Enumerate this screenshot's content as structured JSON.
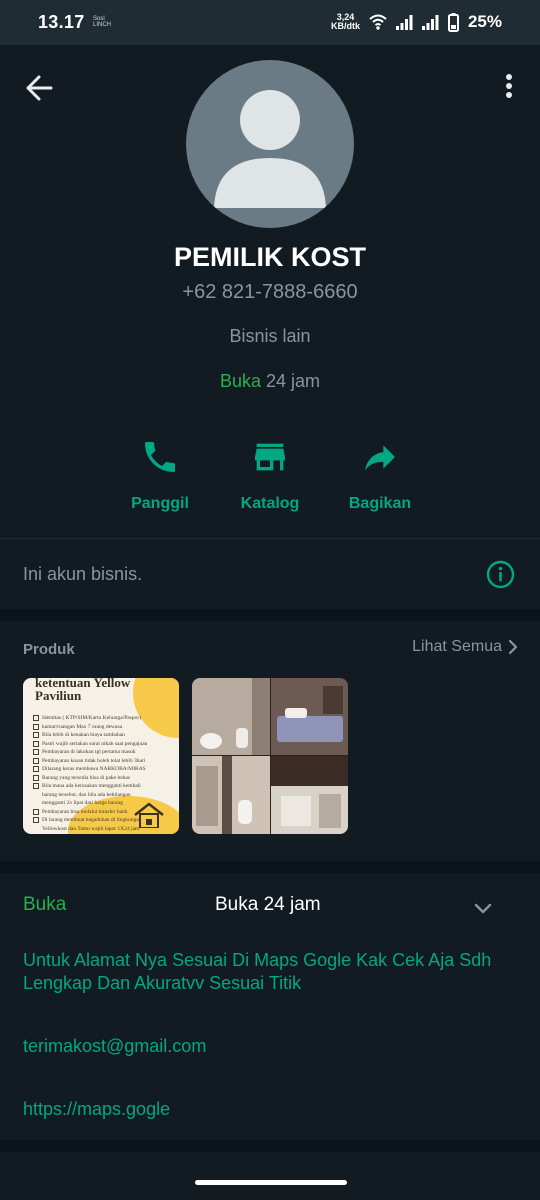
{
  "status_bar": {
    "time": "13.17",
    "mini_text": "Sosl LINCH",
    "speed_value": "3,24",
    "speed_unit": "KB/dtk",
    "battery": "25%"
  },
  "profile": {
    "name": "PEMILIK KOST",
    "phone": "+62 821-7888-6660",
    "category": "Bisnis lain",
    "hours_status": "Buka",
    "hours_detail": "24 jam"
  },
  "actions": [
    {
      "label": "Panggil",
      "icon": "phone-icon"
    },
    {
      "label": "Katalog",
      "icon": "store-icon"
    },
    {
      "label": "Bagikan",
      "icon": "share-icon"
    }
  ],
  "info": {
    "text": "Ini akun bisnis.",
    "icon": "info-icon"
  },
  "products": {
    "title": "Produk",
    "see_all": "Lihat Semua",
    "doc_thumbnail": {
      "title_line1": "ketentuan Yellow",
      "title_line2": "Paviliun",
      "lines": [
        "Identitas ( KTP/SIM/Kartu Keluarga/Paspor)",
        "kamar/ruangan Max 7 orang dewasa",
        "Bila lebih di kenakan biaya tambahan",
        "Pastri wajib sertakan surat nikah saat pengajuan",
        "Pembayaran di lakukan tgl pertama masuk",
        "Pembayaran kosan tidak boleh telat lebih 3hari",
        "Dilarang keras membawa NARKOBA/MIRAS",
        "Barang yang tersedia bisa di pake bebas",
        "Bila mana ada kerusakan mengganti kembali",
        "barang tersebut, dan bila ada kehilangan",
        "mengganti 2x lipat dari harga barang",
        "Pembayaran bisa melalui transfer bank",
        "Di larang membuat kegaduhan di lingkungan",
        "Yellowkost dan Tamu wajib lapor 1X24 jam"
      ]
    }
  },
  "business": {
    "open_label": "Buka",
    "hours": "Buka 24 jam",
    "address": "Untuk  Alamat Nya Sesuai Di Maps Gogle Kak Cek Aja Sdh Lengkap Dan Akuratvv Sesuai Titik",
    "email": "terimakost@gmail.com",
    "website": "https://maps.gogle"
  },
  "colors": {
    "background": "#0b141a",
    "panel": "#121b22",
    "accent": "#00a884",
    "open_green": "#28b14d",
    "muted": "#8696a0"
  }
}
